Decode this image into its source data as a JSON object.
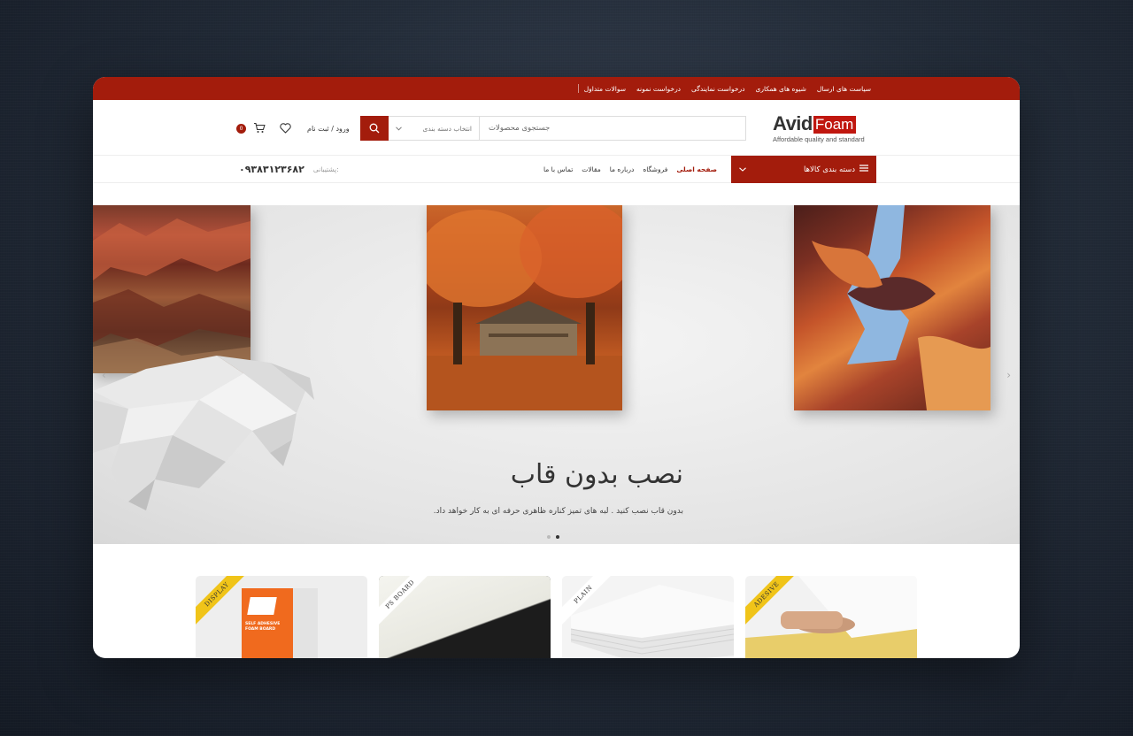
{
  "topbar": {
    "links": [
      "سوالات متداول",
      "درخواست نمونه",
      "درخواست نمایندگی",
      "شیوه های همکاری",
      "سیاست های ارسال"
    ]
  },
  "header": {
    "logo_avid": "Avid",
    "logo_foam": "Foam",
    "logo_tagline": "Affordable quality and standard",
    "search_placeholder": "جستجوی محصولات",
    "category_select": "انتخاب دسته بندی",
    "login_label": "ورود / ثبت نام",
    "cart_count": "0"
  },
  "nav": {
    "categories_label": "دسته بندی کالاها",
    "links": [
      "صفحه اصلی",
      "فروشگاه",
      "درباره ما",
      "مقالات",
      "تماس با ما"
    ],
    "support_label": "پشتیبانی:",
    "support_phone": "۰۹۳۸۳۱۲۳۶۸۲"
  },
  "hero": {
    "title": "نصب بدون قاب",
    "subtitle": "بدون قاب نصب کنید . لبه های تمیز کناره ظاهری حرفه ای به کار خواهد داد.",
    "slide_count": 2,
    "active_slide": 2
  },
  "products": [
    {
      "ribbon": "DISPLAY",
      "style": "gold",
      "card_text": "SELF ADHESIVE FOAM BOARD"
    },
    {
      "ribbon": "PS BOARD",
      "style": "white"
    },
    {
      "ribbon": "PLAIN",
      "style": "white"
    },
    {
      "ribbon": "ADESIVE",
      "style": "gold"
    }
  ],
  "colors": {
    "brand": "#a31c0c",
    "logo_red": "#c0170f"
  }
}
